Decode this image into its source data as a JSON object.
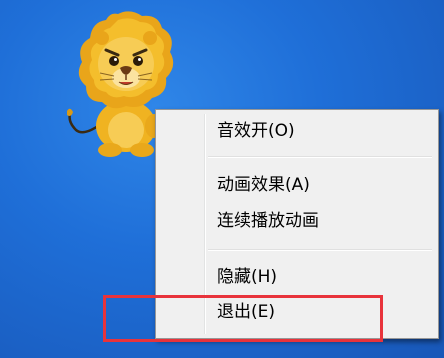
{
  "pet": {
    "icon": "lion-mascot-icon"
  },
  "context_menu": {
    "items": [
      {
        "label": "音效开(O)"
      },
      {
        "label": "动画效果(A)"
      },
      {
        "label": "连续播放动画"
      },
      {
        "label": "隐藏(H)"
      },
      {
        "label": "退出(E)"
      }
    ]
  },
  "colors": {
    "desktop": "#1f6fd8",
    "menu_bg": "#f0f0f0",
    "highlight_border": "#e8333b"
  }
}
